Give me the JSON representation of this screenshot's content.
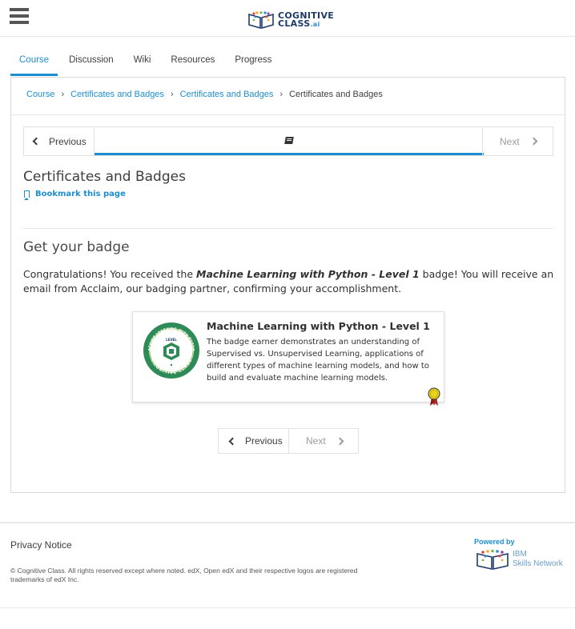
{
  "header": {
    "logo_line1": "COGNITIVE",
    "logo_line2": "CLASS",
    "logo_suffix": ".ai"
  },
  "tabs": [
    {
      "label": "Course",
      "active": true
    },
    {
      "label": "Discussion",
      "active": false
    },
    {
      "label": "Wiki",
      "active": false
    },
    {
      "label": "Resources",
      "active": false
    },
    {
      "label": "Progress",
      "active": false
    }
  ],
  "breadcrumb": {
    "items": [
      "Course",
      "Certificates and Badges",
      "Certificates and Badges"
    ],
    "current": "Certificates and Badges"
  },
  "sequence_nav": {
    "previous_label": "Previous",
    "next_label": "Next",
    "unit_icon": "book-icon"
  },
  "unit": {
    "title": "Certificates and Badges",
    "bookmark_label": "Bookmark this page"
  },
  "content": {
    "heading": "Get your badge",
    "congrats_prefix": "Congratulations! You received the ",
    "congrats_badge": "Machine Learning with Python - Level 1",
    "congrats_suffix": " badge! You will receive an email from Acclaim, our badging partner, confirming your accomplishment."
  },
  "badge": {
    "title": "Machine Learning with Python - Level 1",
    "description": "The badge earner demonstrates an understanding of Supervised vs. Unsupervised Learning, applications of different types of machine learning models, and how to build and evaluate machine learning models.",
    "ring_text_top": "MACHINE LEARNING WITH PYTHON",
    "ring_text_bottom": "COGNITIVE CLASS",
    "center_text": "LEVEL"
  },
  "bottom_nav": {
    "previous_label": "Previous",
    "next_label": "Next"
  },
  "footer": {
    "privacy": "Privacy Notice",
    "copyright": "© Cognitive Class. All rights reserved except where noted. edX, Open edX and their respective logos are registered trademarks of edX Inc.",
    "powered_by": "Powered by",
    "ibm_line1": "IBM",
    "ibm_line2": "Skills Network"
  },
  "colors": {
    "accent": "#1d8ed0",
    "badge_green": "#2e8b57",
    "ribbon_gold": "#e8d51e"
  }
}
